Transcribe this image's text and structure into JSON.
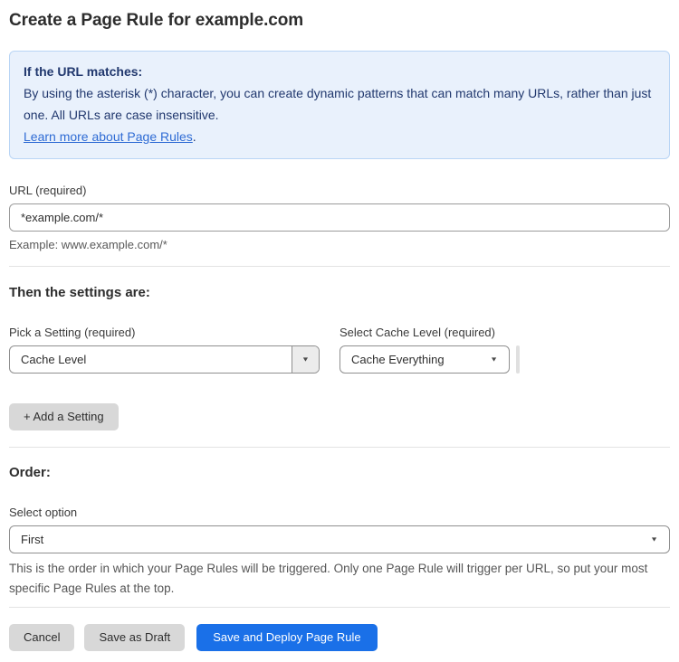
{
  "page": {
    "title": "Create a Page Rule for example.com"
  },
  "info_box": {
    "heading": "If the URL matches:",
    "body": "By using the asterisk (*) character, you can create dynamic patterns that can match many URLs, rather than just one. All URLs are case insensitive.",
    "link_label": "Learn more about Page Rules",
    "link_suffix": "."
  },
  "url_field": {
    "label": "URL (required)",
    "value": "*example.com/*",
    "example": "Example: www.example.com/*"
  },
  "settings_section": {
    "heading": "Then the settings are:",
    "setting_picker": {
      "label": "Pick a Setting (required)",
      "value": "Cache Level"
    },
    "cache_level_picker": {
      "label": "Select Cache Level (required)",
      "value": "Cache Everything"
    },
    "add_setting_label": "+ Add a Setting"
  },
  "order_section": {
    "heading": "Order:",
    "select_label": "Select option",
    "selected_value": "First",
    "help_text": "This is the order in which your Page Rules will be triggered. Only one Page Rule will trigger per URL, so put your most specific Page Rules at the top."
  },
  "footer": {
    "cancel_label": "Cancel",
    "save_draft_label": "Save as Draft",
    "save_deploy_label": "Save and Deploy Page Rule"
  },
  "colors": {
    "info_bg": "#e9f1fc",
    "info_border": "#b9d5f5",
    "info_text": "#21386e",
    "link": "#2e6bd4",
    "primary_button": "#1a70e8",
    "secondary_button": "#d8d8d8"
  },
  "icons": {
    "dropdown_arrow": "▼"
  }
}
